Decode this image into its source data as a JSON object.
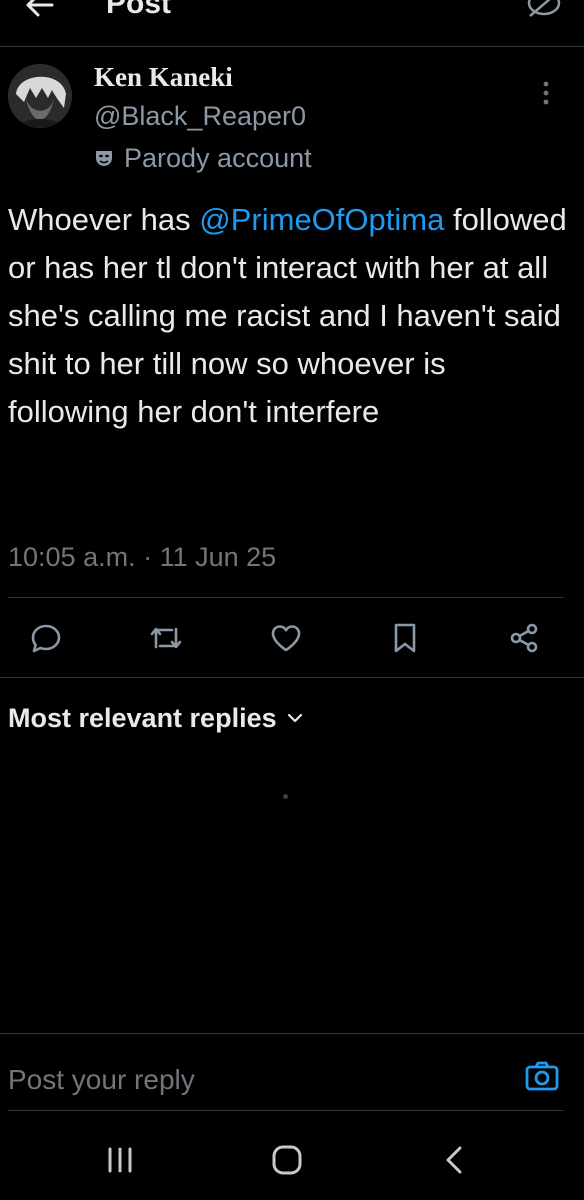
{
  "header": {
    "title": "Post"
  },
  "author": {
    "display_name": "Ken Kaneki",
    "handle": "@Black_Reaper0",
    "badge_label": "Parody account"
  },
  "post": {
    "text_before": "Whoever has ",
    "mention": "@PrimeOfOptima",
    "text_after": " followed or has her tl don't interact with her at all she's calling me racist and I haven't said shit to her till now so whoever is following her don't interfere",
    "timestamp": "10:05 a.m. · 11 Jun 25"
  },
  "actions": [
    "reply-icon",
    "repost-icon",
    "like-icon",
    "bookmark-icon",
    "share-icon"
  ],
  "replies": {
    "sort_label": "Most relevant replies"
  },
  "composer": {
    "placeholder": "Post your reply"
  },
  "colors": {
    "background": "#000000",
    "accent": "#1d9bf0",
    "text": "#e7e9ea",
    "muted": "#71767b",
    "divider": "#2f3336"
  }
}
